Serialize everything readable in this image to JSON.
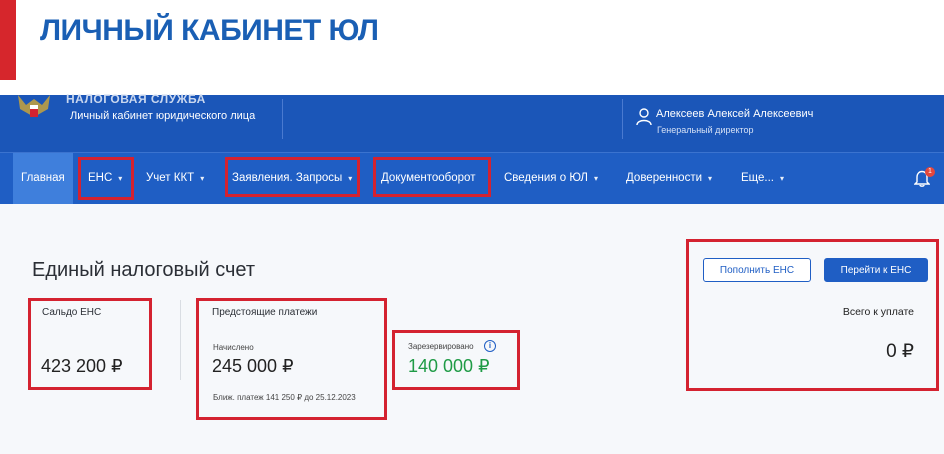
{
  "slide": {
    "title": "ЛИЧНЫЙ КАБИНЕТ ЮЛ"
  },
  "header": {
    "service_name": "НАЛОГОВАЯ СЛУЖБА",
    "cabinet_name": "Личный кабинет юридического лица",
    "user_name": "Алексеев Алексей Алексеевич",
    "user_role": "Генеральный директор"
  },
  "nav": {
    "items": [
      {
        "label": "Главная",
        "dropdown": false,
        "active": true
      },
      {
        "label": "ЕНС",
        "dropdown": true
      },
      {
        "label": "Учет ККТ",
        "dropdown": true
      },
      {
        "label": "Заявления. Запросы",
        "dropdown": true
      },
      {
        "label": "Документооборот",
        "dropdown": false
      },
      {
        "label": "Сведения о ЮЛ",
        "dropdown": true
      },
      {
        "label": "Доверенности",
        "dropdown": true
      },
      {
        "label": "Еще...",
        "dropdown": true
      }
    ],
    "notifications_badge": "1"
  },
  "main": {
    "title": "Единый налоговый счет",
    "saldo": {
      "label": "Сальдо ЕНС",
      "value": "423 200 ₽"
    },
    "upcoming": {
      "label": "Предстоящие платежи",
      "accrued_label": "Начислено",
      "accrued_value": "245 000 ₽",
      "next_payment": "Ближ. платеж 141 250 ₽ до 25.12.2023"
    },
    "reserved": {
      "label": "Зарезервировано",
      "value": "140 000 ₽"
    },
    "actions": {
      "top_up_label": "Пополнить ЕНС",
      "go_label": "Перейти к ЕНС"
    },
    "total": {
      "label": "Всего к уплате",
      "value": "0 ₽"
    }
  },
  "colors": {
    "accent_red": "#d42230",
    "brand_blue": "#1f5ec4",
    "header_blue": "#1b56b8",
    "amount_green": "#1f9b46"
  },
  "icons": {
    "emblem": "coat-of-arms-icon",
    "user": "user-icon",
    "notifications": "bell-icon",
    "info": "info-icon",
    "dropdown": "caret-down-icon"
  }
}
